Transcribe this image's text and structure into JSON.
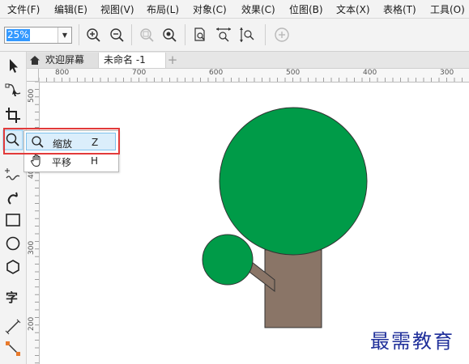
{
  "menubar": {
    "items": [
      "文件(F)",
      "编辑(E)",
      "视图(V)",
      "布局(L)",
      "对象(C)",
      "效果(C)",
      "位图(B)",
      "文本(X)",
      "表格(T)",
      "工具(O)"
    ]
  },
  "toolbar": {
    "zoom_value": "25%",
    "icons": [
      "zoom-in-icon",
      "zoom-out-icon",
      "zoom-selected-icon",
      "zoom-all-icon",
      "zoom-page-icon",
      "zoom-width-icon",
      "zoom-height-icon",
      "add-icon"
    ]
  },
  "tabs": {
    "welcome_label": "欢迎屏幕",
    "document_label": "未命名 -1",
    "add_label": "+"
  },
  "ruler": {
    "h_labels": [
      "800",
      "700",
      "600",
      "500",
      "400",
      "300"
    ],
    "v_labels": [
      "500",
      "400",
      "300",
      "200"
    ]
  },
  "flyout": {
    "zoom_label": "缩放",
    "zoom_key": "Z",
    "pan_label": "平移",
    "pan_key": "H"
  },
  "colors": {
    "canopy": "#009b48",
    "trunk": "#8a7567",
    "highlight": "#e23a3a",
    "watermark": "#1f2f9a"
  },
  "watermark": "最需教育"
}
